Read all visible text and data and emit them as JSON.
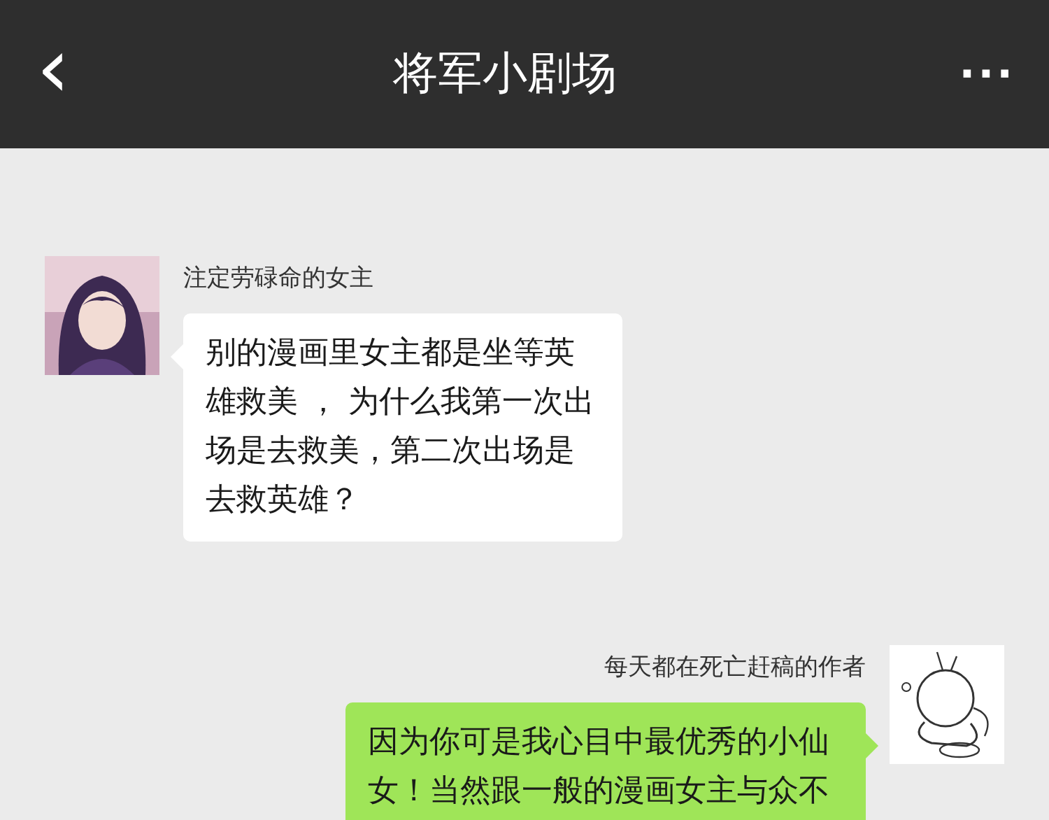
{
  "header": {
    "back": "‹",
    "title": "将军小剧场",
    "more": "···"
  },
  "messages": [
    {
      "kind": "incoming",
      "sender": "注定劳碌命的女主",
      "text": "别的漫画里女主都是坐等英雄救美 ， 为什么我第一次出场是去救美，第二次出场是去救英雄？"
    },
    {
      "kind": "outgoing",
      "sender": "每天都在死亡赶稿的作者",
      "text": "因为你可是我心目中最优秀的小仙女！当然跟一般的漫画女主与众不"
    }
  ]
}
